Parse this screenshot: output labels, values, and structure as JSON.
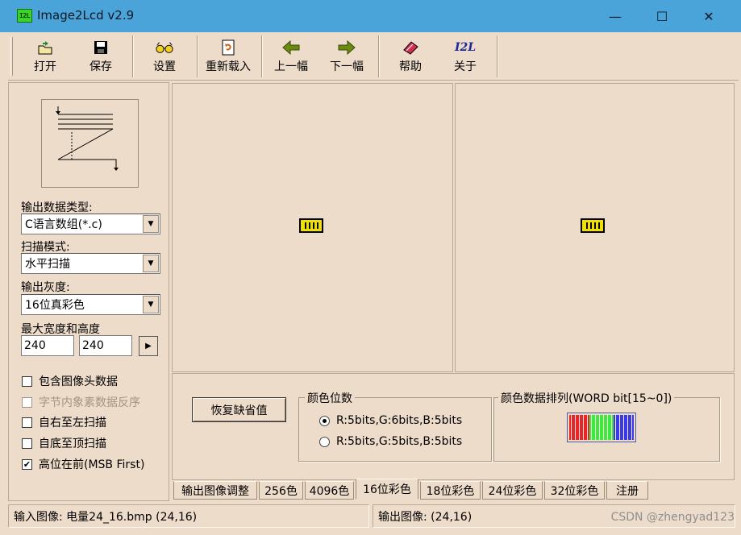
{
  "window": {
    "app_icon_text": "I2L",
    "title": "Image2Lcd v2.9",
    "minimize_glyph": "—",
    "maximize_glyph": "☐",
    "close_glyph": "✕"
  },
  "toolbar": {
    "open": "打开",
    "save": "保存",
    "settings": "设置",
    "reload": "重新载入",
    "prev": "上一幅",
    "next": "下一幅",
    "help": "帮助",
    "about": "关于",
    "about_icon_text": "I2L"
  },
  "left": {
    "output_type_label": "输出数据类型:",
    "output_type_value": "C语言数组(*.c)",
    "scan_mode_label": "扫描模式:",
    "scan_mode_value": "水平扫描",
    "gray_label": "输出灰度:",
    "gray_value": "16位真彩色",
    "max_size_label": "最大宽度和高度",
    "max_width": "240",
    "max_height": "240",
    "checkboxes": [
      {
        "label": "包含图像头数据",
        "checked": false,
        "enabled": true
      },
      {
        "label": "字节内象素数据反序",
        "checked": false,
        "enabled": false
      },
      {
        "label": "自右至左扫描",
        "checked": false,
        "enabled": true
      },
      {
        "label": "自底至顶扫描",
        "checked": false,
        "enabled": true
      },
      {
        "label": "高位在前(MSB First)",
        "checked": true,
        "enabled": true
      }
    ]
  },
  "settings": {
    "restore_button": "恢复缺省值",
    "color_bits_title": "颜色位数",
    "radio_1": "R:5bits,G:6bits,B:5bits",
    "radio_2": "R:5bits,G:5bits,B:5bits",
    "selected_radio": 1,
    "color_order_title": "颜色数据排列(WORD bit[15~0])",
    "stripe_colors": [
      "#e8262a",
      "#e8262a",
      "#e8262a",
      "#e8262a",
      "#e8262a",
      "#3ee83e",
      "#3ee83e",
      "#3ee83e",
      "#3ee83e",
      "#3ee83e",
      "#3ee83e",
      "#3a3ae8",
      "#3a3ae8",
      "#3a3ae8",
      "#3a3ae8",
      "#3a3ae8"
    ]
  },
  "tabs": {
    "output_adjust": "输出图像调整",
    "c256": "256色",
    "c4096": "4096色",
    "c16": "16位彩色",
    "c18": "18位彩色",
    "c24": "24位彩色",
    "c32": "32位彩色",
    "register": "注册",
    "active": "c16"
  },
  "status": {
    "input": "输入图像: 电量24_16.bmp (24,16)",
    "output": "输出图像: (24,16)"
  },
  "watermark": "CSDN @zhengyad123"
}
